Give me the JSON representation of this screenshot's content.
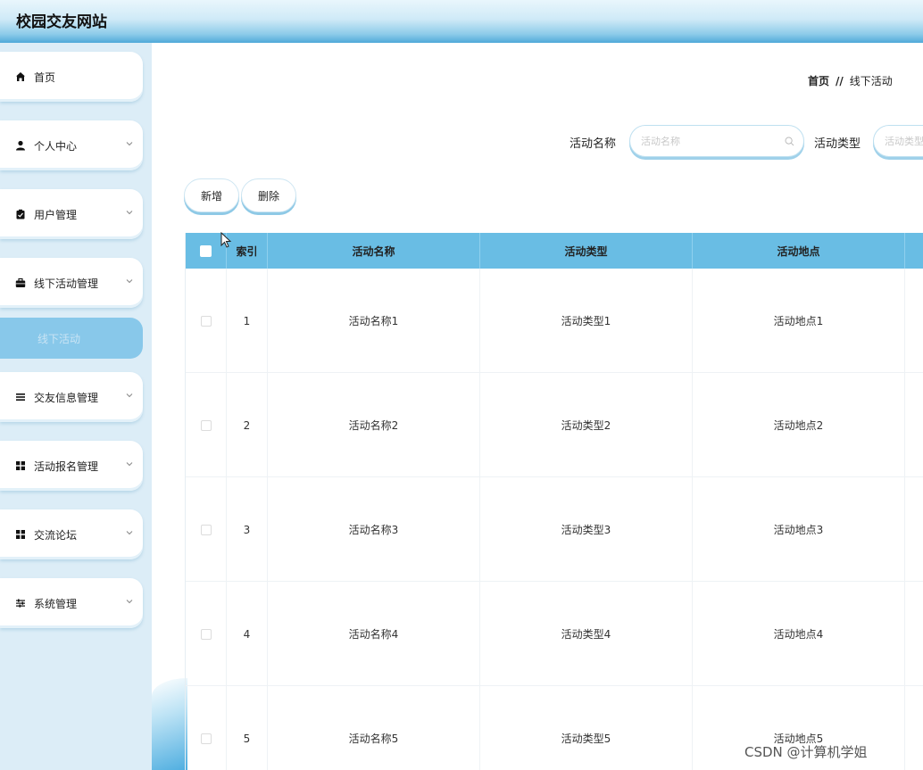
{
  "app": {
    "title": "校园交友网站"
  },
  "sidebar": {
    "items": [
      {
        "label": "首页",
        "icon": "home-icon",
        "has_chevron": false
      },
      {
        "label": "个人中心",
        "icon": "user-icon",
        "has_chevron": true
      },
      {
        "label": "用户管理",
        "icon": "clipboard-icon",
        "has_chevron": true
      },
      {
        "label": "线下活动管理",
        "icon": "briefcase-icon",
        "has_chevron": true
      },
      {
        "label": "交友信息管理",
        "icon": "list-icon",
        "has_chevron": true
      },
      {
        "label": "活动报名管理",
        "icon": "grid-icon",
        "has_chevron": true
      },
      {
        "label": "交流论坛",
        "icon": "grid-icon",
        "has_chevron": true
      },
      {
        "label": "系统管理",
        "icon": "sliders-icon",
        "has_chevron": true
      }
    ],
    "active_subitem": "线下活动"
  },
  "breadcrumb": {
    "home": "首页",
    "separator": "//",
    "current": "线下活动"
  },
  "search": {
    "name_label": "活动名称",
    "name_placeholder": "活动名称",
    "type_label": "活动类型",
    "type_placeholder": "活动类型"
  },
  "actions": {
    "add": "新增",
    "delete": "删除"
  },
  "table": {
    "columns": [
      "索引",
      "活动名称",
      "活动类型",
      "活动地点"
    ],
    "rows": [
      [
        "1",
        "活动名称1",
        "活动类型1",
        "活动地点1"
      ],
      [
        "2",
        "活动名称2",
        "活动类型2",
        "活动地点2"
      ],
      [
        "3",
        "活动名称3",
        "活动类型3",
        "活动地点3"
      ],
      [
        "4",
        "活动名称4",
        "活动类型4",
        "活动地点4"
      ],
      [
        "5",
        "活动名称5",
        "活动类型5",
        "活动地点5"
      ]
    ]
  },
  "watermark": "CSDN @计算机学姐",
  "colors": {
    "accent": "#69bde4",
    "header_gradient_end": "#4fa9d9",
    "sidebar_bg": "#dcedf7",
    "active_item": "#88c8ea"
  }
}
